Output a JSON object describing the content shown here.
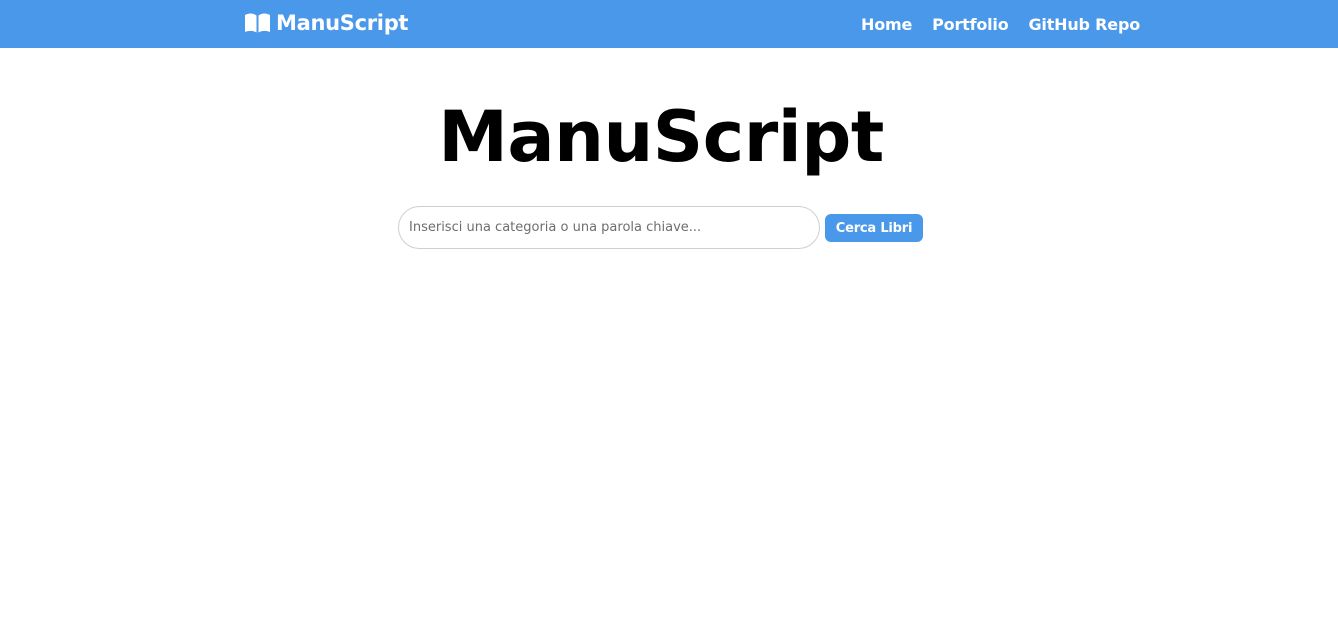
{
  "navbar": {
    "brand": {
      "icon": "open-book-icon",
      "label": "ManuScript"
    },
    "links": [
      {
        "label": "Home"
      },
      {
        "label": "Portfolio"
      },
      {
        "label": "GitHub Repo"
      }
    ],
    "background_color": "#4a98ea"
  },
  "hero": {
    "title": "ManuScript"
  },
  "search": {
    "placeholder": "Inserisci una categoria o una parola chiave...",
    "value": "",
    "button_label": "Cerca Libri"
  },
  "colors": {
    "accent": "#4a98ea",
    "text": "#000000",
    "background": "#ffffff"
  }
}
